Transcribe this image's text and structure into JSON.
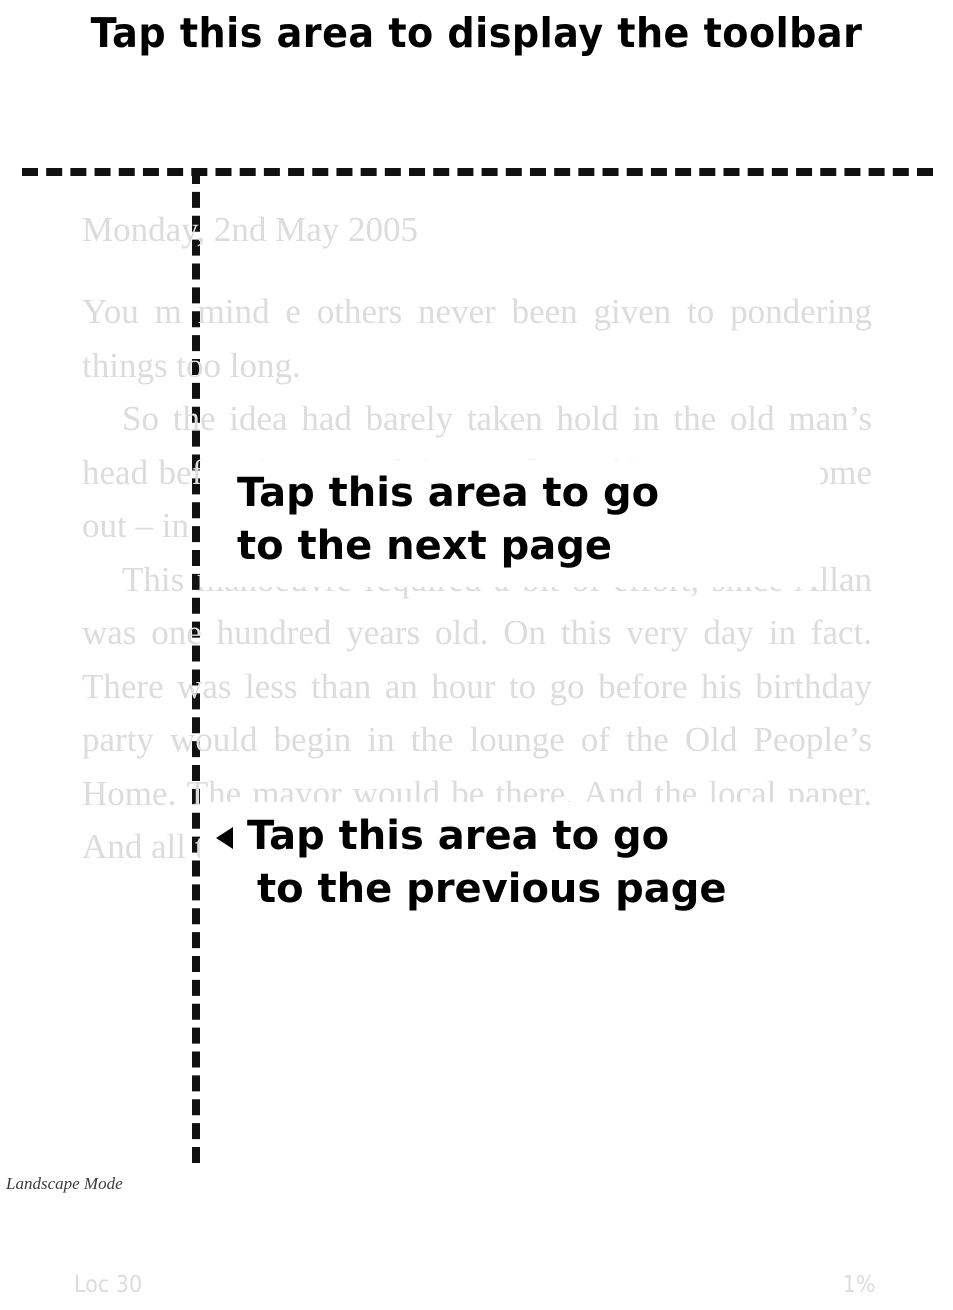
{
  "screen": {
    "type": "e-reader-help-overlay",
    "orientation_caption": "Landscape Mode",
    "colors": {
      "background": "#ffffff",
      "overlay_text": "#000000",
      "book_text": "#dcdcdc",
      "guide_line": "#111111",
      "caption_text": "#3a3a3a"
    }
  },
  "hints": {
    "toolbar": {
      "label": "Tap this area to display the toolbar"
    },
    "next_page": {
      "line1": "Tap this area to go",
      "line2": "to the next page"
    },
    "previous_page": {
      "arrow_icon": "triangle-left-icon",
      "line1": "Tap this area to go",
      "line2": "to the previous page"
    }
  },
  "reader": {
    "date_heading": "Monday, 2nd May 2005",
    "paragraphs": [
      "You m            mind e            others            never been given to pondering things too long.",
      "So the idea had barely taken hold in the old man’s head before he opened the window of his room   (              Home                out – in",
      "This manoeuvre required a bit of effort, since Allan was one hundred years old. On this very day in fact. There was less than an hour to go before his birthday party would begin in the lounge of the Old People’s Home. The mayor would be there. And the local paper. And all the"
    ],
    "status": {
      "location_label": "Loc 30",
      "progress_label": "1%"
    }
  }
}
